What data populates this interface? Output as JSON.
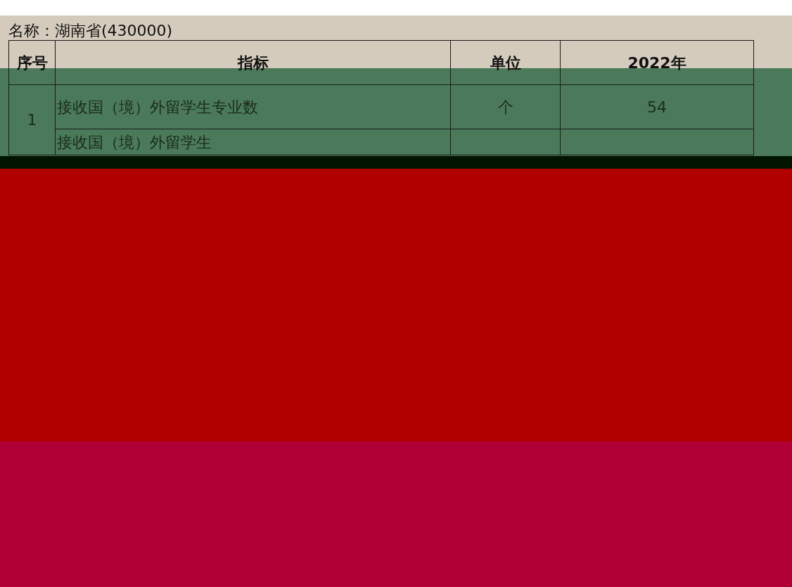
{
  "title": "名称：湖南省(430000)",
  "table": {
    "columns": [
      "序号",
      "指标",
      "单位",
      "2022年"
    ],
    "rows": [
      {
        "index": "1",
        "items": [
          {
            "indicator": "接收国（境）外留学生专业数",
            "unit": "个",
            "value": "54"
          },
          {
            "indicator": "接收国（境）外留学生"
          }
        ]
      }
    ]
  }
}
